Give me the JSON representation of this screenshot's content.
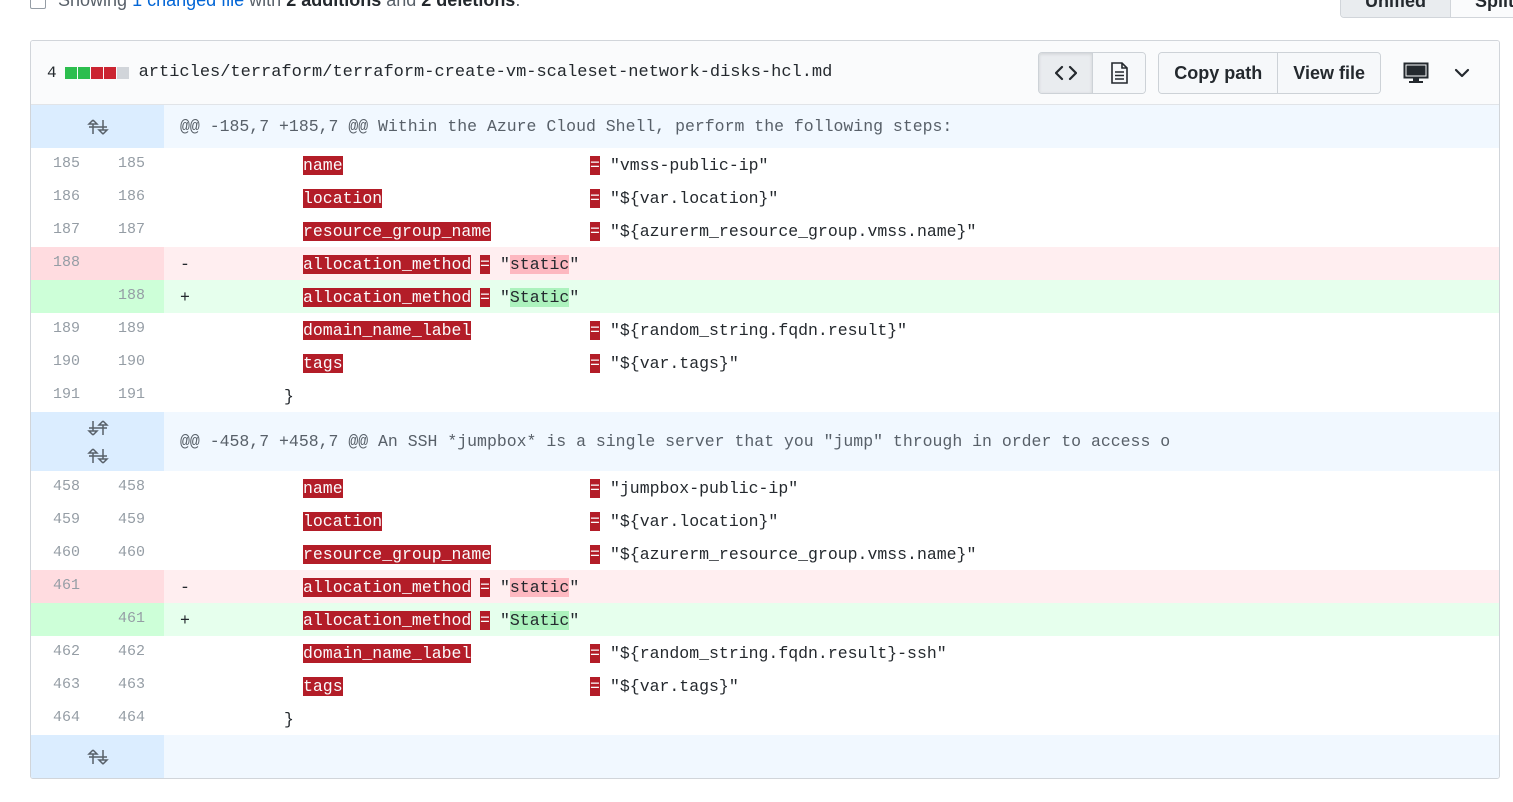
{
  "toolbar": {
    "showing_prefix": "Showing",
    "changed_files_link": "1 changed file",
    "with_text": "with",
    "additions": "2 additions",
    "and_text": "and",
    "deletions": "2 deletions",
    "period": ".",
    "unified_label": "Unified",
    "split_label": "Split"
  },
  "file": {
    "change_count": "4",
    "path": "articles/terraform/terraform-create-vm-scaleset-network-disks-hcl.md",
    "copy_path_label": "Copy path",
    "view_file_label": "View file",
    "diffstat": [
      "add",
      "add",
      "del",
      "del",
      "neutral"
    ],
    "colors": {
      "addition": "#2cbe4e",
      "deletion": "#cb2431",
      "neutral": "#d1d5da"
    },
    "icons": [
      "code-icon",
      "file-text-icon",
      "desktop-icon",
      "chevron-down-icon"
    ]
  },
  "hunks": [
    {
      "header": "@@ -185,7 +185,7 @@ Within the Azure Cloud Shell, perform the following steps:",
      "lines": [
        {
          "type": "ctx",
          "old": "185",
          "new": "185",
          "key": "name",
          "value": "\"vmss-public-ip\""
        },
        {
          "type": "ctx",
          "old": "186",
          "new": "186",
          "key": "location",
          "value": "\"${var.location}\""
        },
        {
          "type": "ctx",
          "old": "187",
          "new": "187",
          "key": "resource_group_name",
          "value": "\"${azurerm_resource_group.vmss.name}\""
        },
        {
          "type": "del",
          "old": "188",
          "new": "",
          "sign": "-",
          "key": "allocation_method",
          "q1": "\"",
          "word": "static",
          "q2": "\""
        },
        {
          "type": "add",
          "old": "",
          "new": "188",
          "sign": "+",
          "key": "allocation_method",
          "q1": "\"",
          "word": "Static",
          "q2": "\""
        },
        {
          "type": "ctx",
          "old": "189",
          "new": "189",
          "key": "domain_name_label",
          "value": "\"${random_string.fqdn.result}\""
        },
        {
          "type": "ctx",
          "old": "190",
          "new": "190",
          "key": "tags",
          "value": "\"${var.tags}\""
        },
        {
          "type": "brace",
          "old": "191",
          "new": "191",
          "text": "}"
        }
      ]
    },
    {
      "header": "@@ -458,7 +458,7 @@ An SSH *jumpbox* is a single server that you \"jump\" through in order to access o",
      "lines": [
        {
          "type": "ctx",
          "old": "458",
          "new": "458",
          "key": "name",
          "value": "\"jumpbox-public-ip\""
        },
        {
          "type": "ctx",
          "old": "459",
          "new": "459",
          "key": "location",
          "value": "\"${var.location}\""
        },
        {
          "type": "ctx",
          "old": "460",
          "new": "460",
          "key": "resource_group_name",
          "value": "\"${azurerm_resource_group.vmss.name}\""
        },
        {
          "type": "del",
          "old": "461",
          "new": "",
          "sign": "-",
          "key": "allocation_method",
          "q1": "\"",
          "word": "static",
          "q2": "\""
        },
        {
          "type": "add",
          "old": "",
          "new": "461",
          "sign": "+",
          "key": "allocation_method",
          "q1": "\"",
          "word": "Static",
          "q2": "\""
        },
        {
          "type": "ctx",
          "old": "462",
          "new": "462",
          "key": "domain_name_label",
          "value": "\"${random_string.fqdn.result}-ssh\""
        },
        {
          "type": "ctx",
          "old": "463",
          "new": "463",
          "key": "tags",
          "value": "\"${var.tags}\""
        },
        {
          "type": "brace",
          "old": "464",
          "new": "464",
          "text": "}"
        }
      ]
    }
  ],
  "eq_sign": "="
}
